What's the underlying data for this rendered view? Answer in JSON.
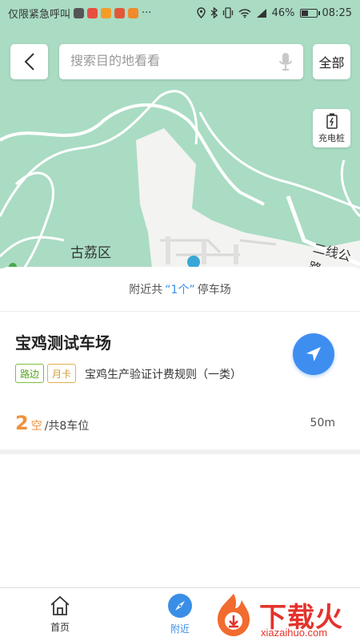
{
  "status_bar": {
    "carrier_text": "仅限紧急呼叫",
    "more": "···",
    "battery": "46%",
    "time": "08:25",
    "battery_level": 0.46
  },
  "map": {
    "district_label": "古荔区",
    "road_label": "二线公路"
  },
  "search": {
    "placeholder": "搜索目的地看看",
    "value": ""
  },
  "buttons": {
    "all_label": "全部",
    "charge_label": "充电桩"
  },
  "nearby": {
    "prefix": "附近共",
    "count": "“1个”",
    "suffix": "停车场"
  },
  "lot": {
    "name": "宝鸡测试车场",
    "tags": [
      "路边",
      "月卡"
    ],
    "rule": "宝鸡生产验证计费规则（一类）",
    "free_spaces": "2",
    "free_label": "空",
    "total_label": "/共8车位",
    "distance": "50m"
  },
  "bottom_nav": {
    "items": [
      {
        "label": "首页",
        "icon": "home-icon"
      },
      {
        "label": "附近",
        "icon": "compass-icon"
      }
    ]
  },
  "watermark": {
    "text": "下载火",
    "url": "xiazaihuo.com"
  },
  "colors": {
    "accent": "#3a8ee6",
    "nav_button": "#3e8ef0",
    "free_spaces": "#f0913a",
    "tag_road": "#5aa620",
    "tag_month": "#d09a30",
    "map_green": "#a9dcc3",
    "watermark_red": "#e3332c"
  }
}
